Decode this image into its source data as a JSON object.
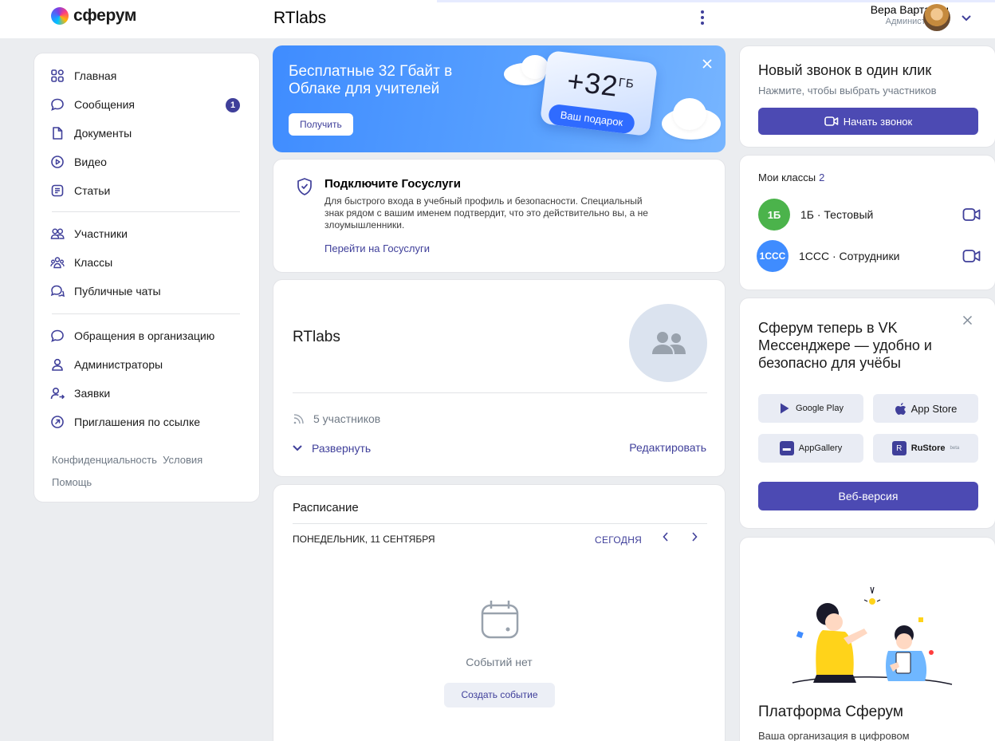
{
  "header": {
    "logo_text": "сферум",
    "org_title": "RTlabs",
    "user_name": "Вера Вартанян",
    "user_role": "Администратор"
  },
  "nav": {
    "items": [
      {
        "label": "Главная",
        "icon": "home-grid-icon"
      },
      {
        "label": "Сообщения",
        "icon": "chat-icon",
        "badge": "1"
      },
      {
        "label": "Документы",
        "icon": "document-icon"
      },
      {
        "label": "Видео",
        "icon": "video-play-icon"
      },
      {
        "label": "Статьи",
        "icon": "article-icon"
      },
      {
        "label": "Участники",
        "icon": "users-icon"
      },
      {
        "label": "Классы",
        "icon": "classes-icon"
      },
      {
        "label": "Публичные чаты",
        "icon": "public-chat-icon"
      },
      {
        "label": "Обращения в организацию",
        "icon": "chat-icon"
      },
      {
        "label": "Администраторы",
        "icon": "user-icon"
      },
      {
        "label": "Заявки",
        "icon": "user-request-icon"
      },
      {
        "label": "Приглашения по ссылке",
        "icon": "link-arrow-icon"
      }
    ],
    "footer_privacy": "Конфиденциальность",
    "footer_terms": "Условия",
    "footer_help": "Помощь"
  },
  "promo": {
    "title": "Бесплатные 32 Гбайт в Облаке для учителей",
    "button": "Получить",
    "gift_amount": "+32",
    "gift_unit": "ГБ",
    "gift_chip": "Ваш подарок"
  },
  "gosuslugi": {
    "title": "Подключите Госуслуги",
    "description": "Для быстрого входа в учебный профиль и безопасности. Специальный знак рядом с вашим именем подтвердит, что это действительно вы, а не злоумышленники.",
    "link": "Перейти на Госуслуги"
  },
  "community": {
    "name": "RTlabs",
    "members": "5 участников",
    "expand": "Развернуть",
    "edit": "Редактировать"
  },
  "schedule": {
    "title": "Расписание",
    "date": "ПОНЕДЕЛЬНИК, 11 СЕНТЯБРЯ",
    "today": "СЕГОДНЯ",
    "empty": "Событий нет",
    "create": "Создать событие"
  },
  "call": {
    "title": "Новый звонок в один клик",
    "subtitle": "Нажмите, чтобы выбрать участников",
    "button": "Начать звонок"
  },
  "classes": {
    "title": "Мои классы",
    "count": "2",
    "items": [
      {
        "avatar": "1Б",
        "name": "1Б · Тестовый",
        "color": "#4bb34b"
      },
      {
        "avatar": "1ССС",
        "name": "1ССС · Сотрудники",
        "color": "#3f8cff"
      }
    ]
  },
  "messenger": {
    "title": "Сферум теперь в VK Мессенджере — удобно и безопасно для учёбы",
    "stores": [
      "Google Play",
      "App Store",
      "AppGallery",
      "RuStore"
    ],
    "rustore_tag": "beta",
    "web": "Веб-версия"
  },
  "platform": {
    "title": "Платформа Сферум",
    "subtitle": "Ваша организация в цифровом"
  },
  "colors": {
    "accent": "#3f3f9a",
    "button": "#4c4ab3",
    "promo": "#3f8cff",
    "page_bg": "#ebedf0"
  }
}
